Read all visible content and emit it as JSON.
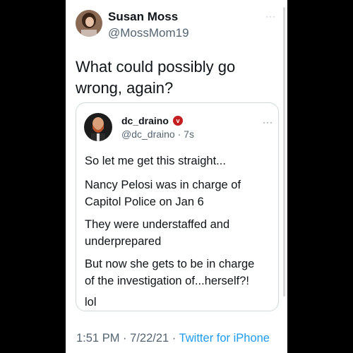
{
  "tweet": {
    "author_name": "Susan Moss",
    "author_handle": "@MossMom19",
    "more_label": "···",
    "text_line1": "What could possibly go",
    "text_line2": "wrong, again?"
  },
  "quoted_tweet": {
    "author_name": "dc_draino",
    "verified_badge": "v",
    "author_handle": "@dc_draino",
    "time_ago": "7s",
    "more_label": "···",
    "paragraphs": [
      "So let me get this straight...",
      "Nancy Pelosi was in charge of",
      "Capitol Police on Jan 6",
      "They were understaffed and",
      "underprepared",
      "But now she gets to be in charge",
      "of the investigation of...herself?!",
      "lol"
    ]
  },
  "footer": {
    "time": "1:51 PM",
    "date": "7/22/21",
    "source": "Twitter for iPhone"
  },
  "colors": {
    "background": "#000000",
    "card": "#ffffff",
    "text": "#0f1419",
    "secondary_text": "#536471",
    "link": "#1d9bf0",
    "badge": "#c41e20"
  }
}
